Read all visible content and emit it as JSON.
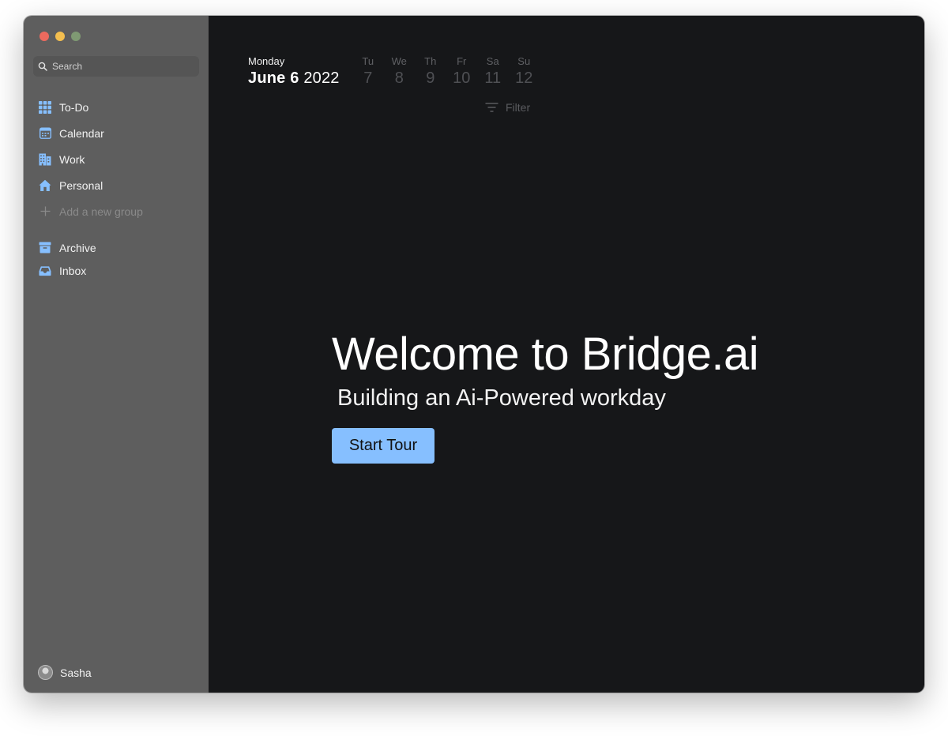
{
  "colors": {
    "close": "#ec6a5e",
    "minimize": "#f4bf4f",
    "zoom": "#7f9a73",
    "accent": "#86bfff",
    "sidebar": "#5e5e5e",
    "main": "#161719"
  },
  "sidebar": {
    "search": {
      "placeholder": "Search",
      "icon": "search-icon"
    },
    "items": [
      {
        "label": "To-Do",
        "icon": "grid-icon"
      },
      {
        "label": "Calendar",
        "icon": "calendar-icon"
      },
      {
        "label": "Work",
        "icon": "building-icon"
      },
      {
        "label": "Personal",
        "icon": "home-icon"
      },
      {
        "label": "Add a new group",
        "icon": "plus-icon"
      }
    ],
    "secondary": [
      {
        "label": "Archive",
        "icon": "archive-icon"
      },
      {
        "label": "Inbox",
        "icon": "inbox-icon"
      }
    ],
    "user": {
      "name": "Sasha",
      "icon": "avatar"
    }
  },
  "header": {
    "weekday": "Monday",
    "date": "June 6",
    "year": "2022",
    "week": [
      {
        "label": "Tu",
        "num": "7"
      },
      {
        "label": "We",
        "num": "8"
      },
      {
        "label": "Th",
        "num": "9"
      },
      {
        "label": "Fr",
        "num": "10"
      },
      {
        "label": "Sa",
        "num": "11"
      },
      {
        "label": "Su",
        "num": "12"
      }
    ],
    "filter": {
      "label": "Filter",
      "icon": "filter-icon"
    }
  },
  "hero": {
    "title": "Welcome to Bridge.ai",
    "subtitle": "Building an Ai-Powered workday",
    "button": "Start Tour"
  }
}
